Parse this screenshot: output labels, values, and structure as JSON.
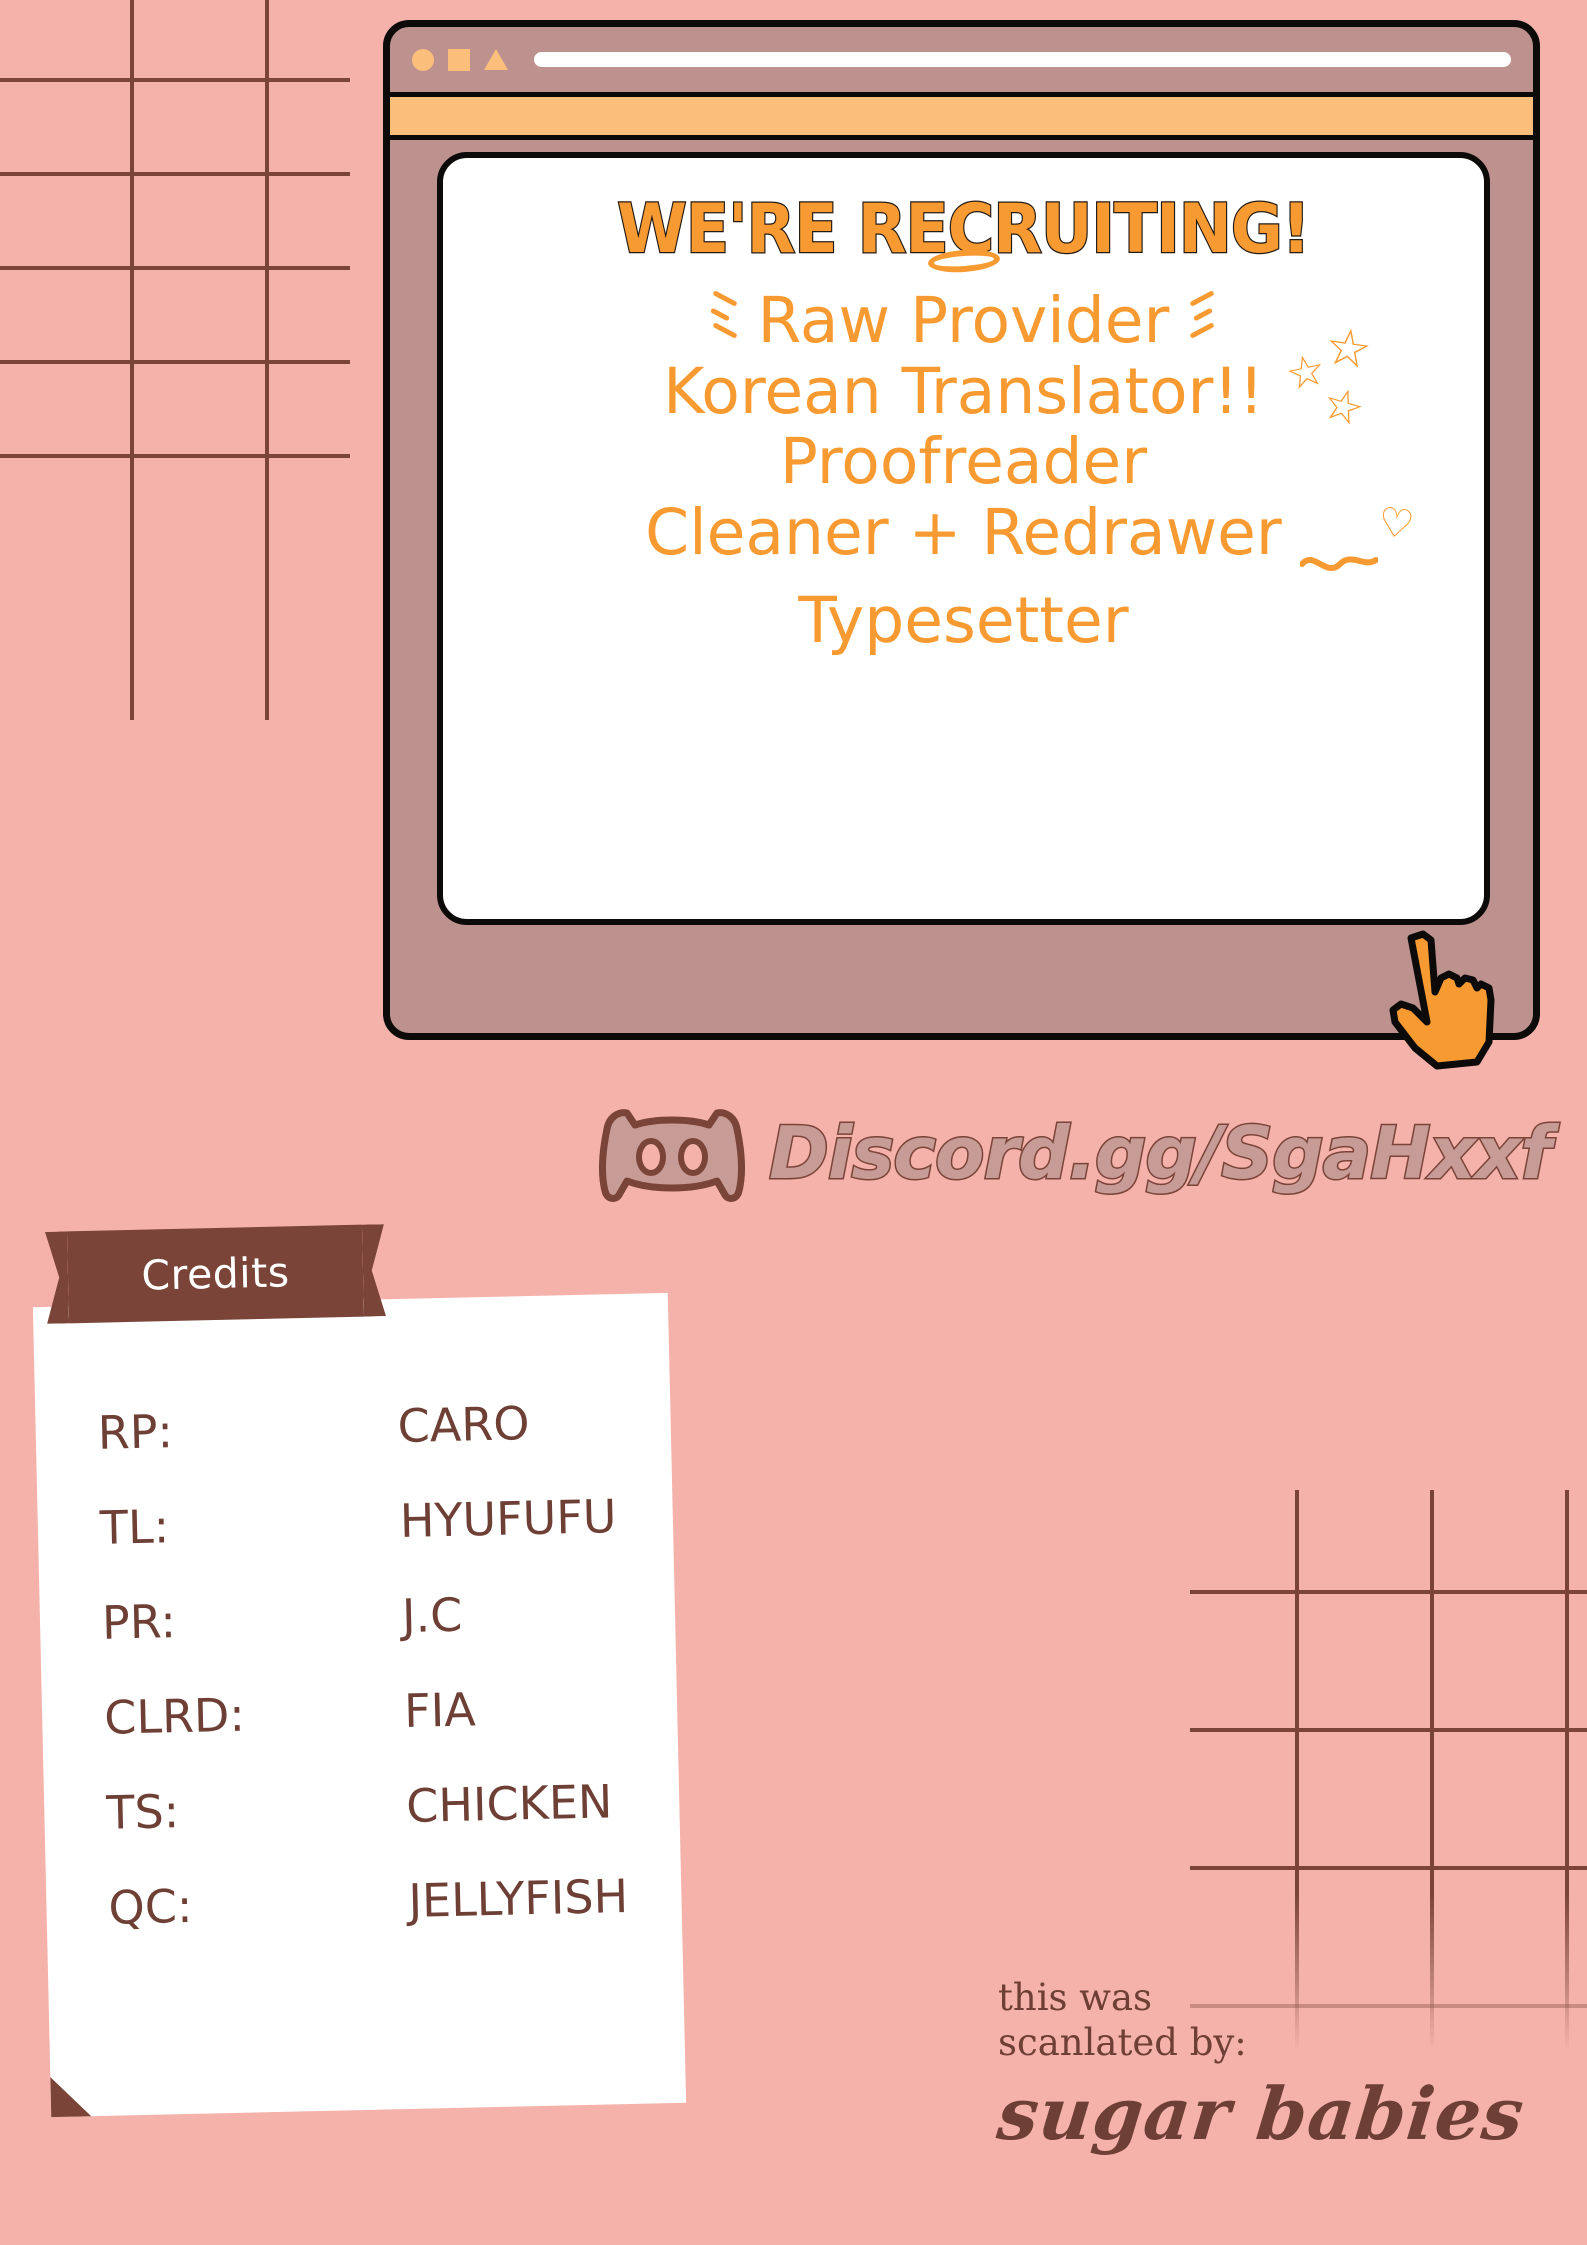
{
  "background": {
    "color": "#f5b2aa",
    "grid_line_color": "#7a4438"
  },
  "browser": {
    "frame_color": "#bd928e",
    "tabstrip_color": "#fcbe7b",
    "outline_color": "#0d0b0a",
    "controls": [
      "circle-icon",
      "square-icon",
      "triangle-icon"
    ],
    "url_bar_value": "",
    "page": {
      "title": "WE'RE RECRUITING!",
      "title_color": "#f79a31",
      "roles": [
        {
          "label": "Raw Provider",
          "decor": "halo-and-sparkles"
        },
        {
          "label": "Korean Translator!!",
          "decor": "stars"
        },
        {
          "label": "Proofreader",
          "decor": "none"
        },
        {
          "label": "Cleaner + Redrawer",
          "decor": "squiggle-and-heart"
        },
        {
          "label": "Typesetter",
          "decor": "none"
        }
      ]
    }
  },
  "cursor": {
    "icon": "pointing-hand-icon",
    "color": "#f79a31"
  },
  "discord": {
    "logo": "discord-logo-icon",
    "handle": "Discord.gg/SgaHxxf",
    "text_color": "#c79b96",
    "outline_color": "#7a4438"
  },
  "credits": {
    "banner_title": "Credits",
    "banner_color": "#7a4438",
    "text_color": "#6e3f34",
    "rows": [
      {
        "label": "RP:",
        "value": "CARO"
      },
      {
        "label": "TL:",
        "value": "HYUFUFU"
      },
      {
        "label": "PR:",
        "value": "J.C"
      },
      {
        "label": "CLRD:",
        "value": "FIA"
      },
      {
        "label": "TS:",
        "value": "CHICKEN"
      },
      {
        "label": "QC:",
        "value": "JELLYFISH"
      }
    ]
  },
  "scanlation": {
    "line1": "this was",
    "line2": "scanlated by:",
    "group": "sugar babies"
  }
}
